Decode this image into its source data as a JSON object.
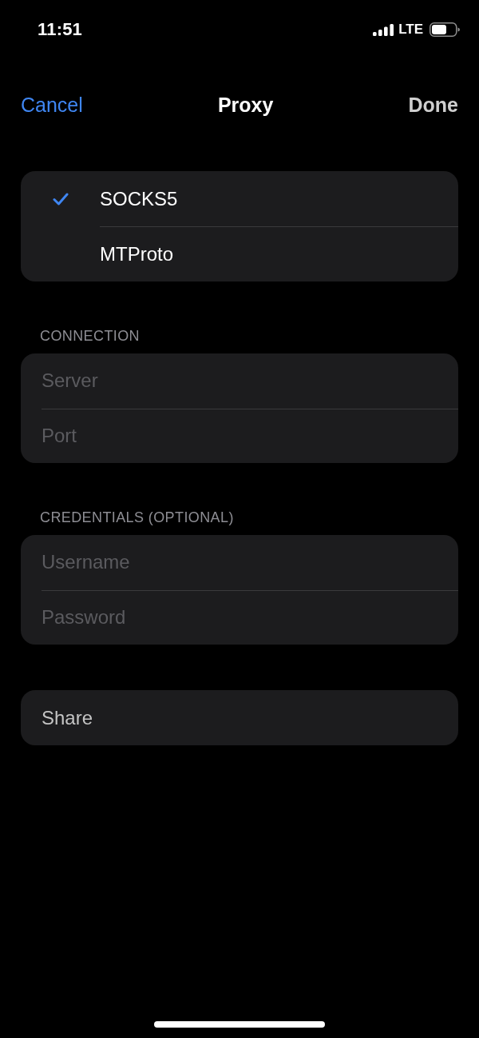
{
  "status_bar": {
    "time": "11:51",
    "network": "LTE"
  },
  "nav_bar": {
    "cancel": "Cancel",
    "title": "Proxy",
    "done": {
      "label": "Done",
      "disabled": true
    }
  },
  "proxy_types": [
    {
      "label": "SOCKS5",
      "selected": true
    },
    {
      "label": "MTProto",
      "selected": false
    }
  ],
  "sections": [
    {
      "header": "CONNECTION",
      "fields": [
        {
          "placeholder": "Server"
        },
        {
          "placeholder": "Port"
        }
      ]
    },
    {
      "header": "CREDENTIALS (OPTIONAL)",
      "fields": [
        {
          "placeholder": "Username"
        },
        {
          "placeholder": "Password"
        }
      ]
    }
  ],
  "share": {
    "label": "Share",
    "disabled": true
  }
}
